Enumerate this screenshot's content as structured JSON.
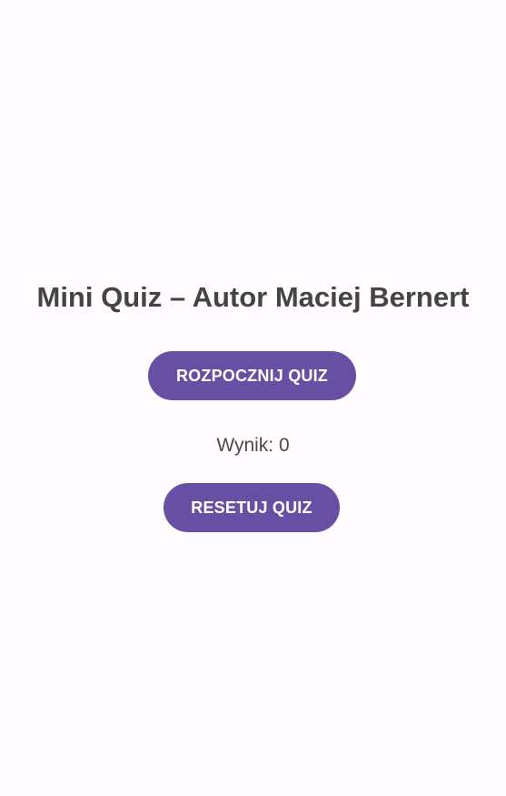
{
  "title": "Mini Quiz – Autor Maciej Bernert",
  "buttons": {
    "start_label": "ROZPOCZNIJ QUIZ",
    "reset_label": "RESETUJ QUIZ"
  },
  "score": {
    "text": "Wynik: 0"
  },
  "colors": {
    "background": "#fffbfe",
    "button": "#6750a4",
    "button_text": "#ffffff",
    "title_text": "#444444"
  }
}
